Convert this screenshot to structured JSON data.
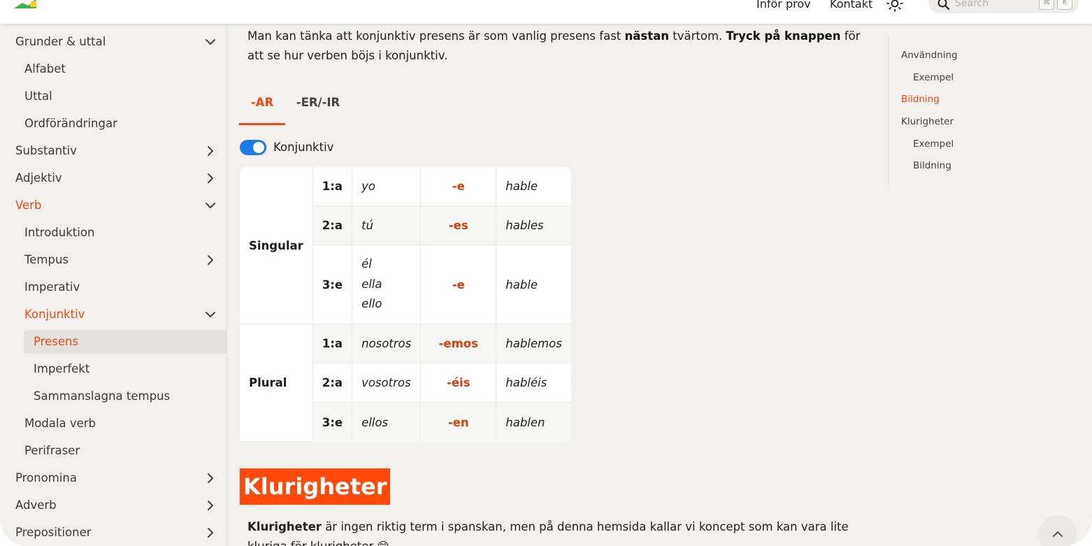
{
  "nav": {
    "links": [
      "Inför prov",
      "Kontakt"
    ],
    "search_placeholder": "Search",
    "kbd_keys": [
      "⌘",
      "K"
    ]
  },
  "sidebar": {
    "items": [
      {
        "label": "Grunder & uttal",
        "level": 0,
        "chevron": "chevron-down"
      },
      {
        "label": "Alfabet",
        "level": 1
      },
      {
        "label": "Uttal",
        "level": 1
      },
      {
        "label": "Ordförändringar",
        "level": 1
      },
      {
        "label": "Substantiv",
        "level": 0,
        "chevron": "chevron-right"
      },
      {
        "label": "Adjektiv",
        "level": 0,
        "chevron": "chevron-right"
      },
      {
        "label": "Verb",
        "level": 0,
        "chevron": "chevron-down",
        "active": true
      },
      {
        "label": "Introduktion",
        "level": 1
      },
      {
        "label": "Tempus",
        "level": 1,
        "chevron": "chevron-right"
      },
      {
        "label": "Imperativ",
        "level": 1
      },
      {
        "label": "Konjunktiv",
        "level": 1,
        "chevron": "chevron-down",
        "active": true
      },
      {
        "label": "Presens",
        "level": 2,
        "active": true,
        "selected": true
      },
      {
        "label": "Imperfekt",
        "level": 2
      },
      {
        "label": "Sammanslagna tempus",
        "level": 2
      },
      {
        "label": "Modala verb",
        "level": 1
      },
      {
        "label": "Perifraser",
        "level": 1
      },
      {
        "label": "Pronomina",
        "level": 0,
        "chevron": "chevron-right"
      },
      {
        "label": "Adverb",
        "level": 0,
        "chevron": "chevron-right"
      },
      {
        "label": "Prepositioner",
        "level": 0,
        "chevron": "chevron-right"
      }
    ]
  },
  "content": {
    "intro_1": "Man kan tänka att konjunktiv presens är som vanlig presens fast ",
    "intro_b1": "nästan",
    "intro_2": " tvärtom. ",
    "intro_b2": "Tryck på knappen",
    "intro_3": " för att se hur verben böjs i konjunktiv.",
    "tabs": [
      "-AR",
      "-ER/-IR"
    ],
    "toggle_label": "Konjunktiv",
    "table": {
      "singular_label": "Singular",
      "plural_label": "Plural",
      "rows": [
        {
          "person": "1:a",
          "pronouns": [
            "yo"
          ],
          "ending": "-e",
          "verb": "hable"
        },
        {
          "person": "2:a",
          "pronouns": [
            "tú"
          ],
          "ending": "-es",
          "verb": "hables"
        },
        {
          "person": "3:e",
          "pronouns": [
            "él",
            "ella",
            "ello"
          ],
          "ending": "-e",
          "verb": "hable"
        },
        {
          "person": "1:a",
          "pronouns": [
            "nosotros"
          ],
          "ending": "-emos",
          "verb": "hablemos"
        },
        {
          "person": "2:a",
          "pronouns": [
            "vosotros"
          ],
          "ending": "-éis",
          "verb": "habléis"
        },
        {
          "person": "3:e",
          "pronouns": [
            "ellos"
          ],
          "ending": "-en",
          "verb": "hablen"
        }
      ]
    },
    "heading": "Klurigheter",
    "para_b": "Klurigheter",
    "para_rest": " är ingen riktig term i spanskan, men på denna hemsida kallar vi koncept som kan vara lite kluriga för klurigheter 😁"
  },
  "toc": {
    "items": [
      {
        "label": "Användning",
        "level": 0
      },
      {
        "label": "Exempel",
        "level": 1
      },
      {
        "label": "Bildning",
        "level": 0,
        "active": true
      },
      {
        "label": "Klurigheter",
        "level": 0
      },
      {
        "label": "Exempel",
        "level": 1
      },
      {
        "label": "Bildning",
        "level": 1
      }
    ]
  },
  "colors": {
    "accent": "#f04a14",
    "toggle": "#1f7be6",
    "heading_bg": "#ff4a09"
  }
}
